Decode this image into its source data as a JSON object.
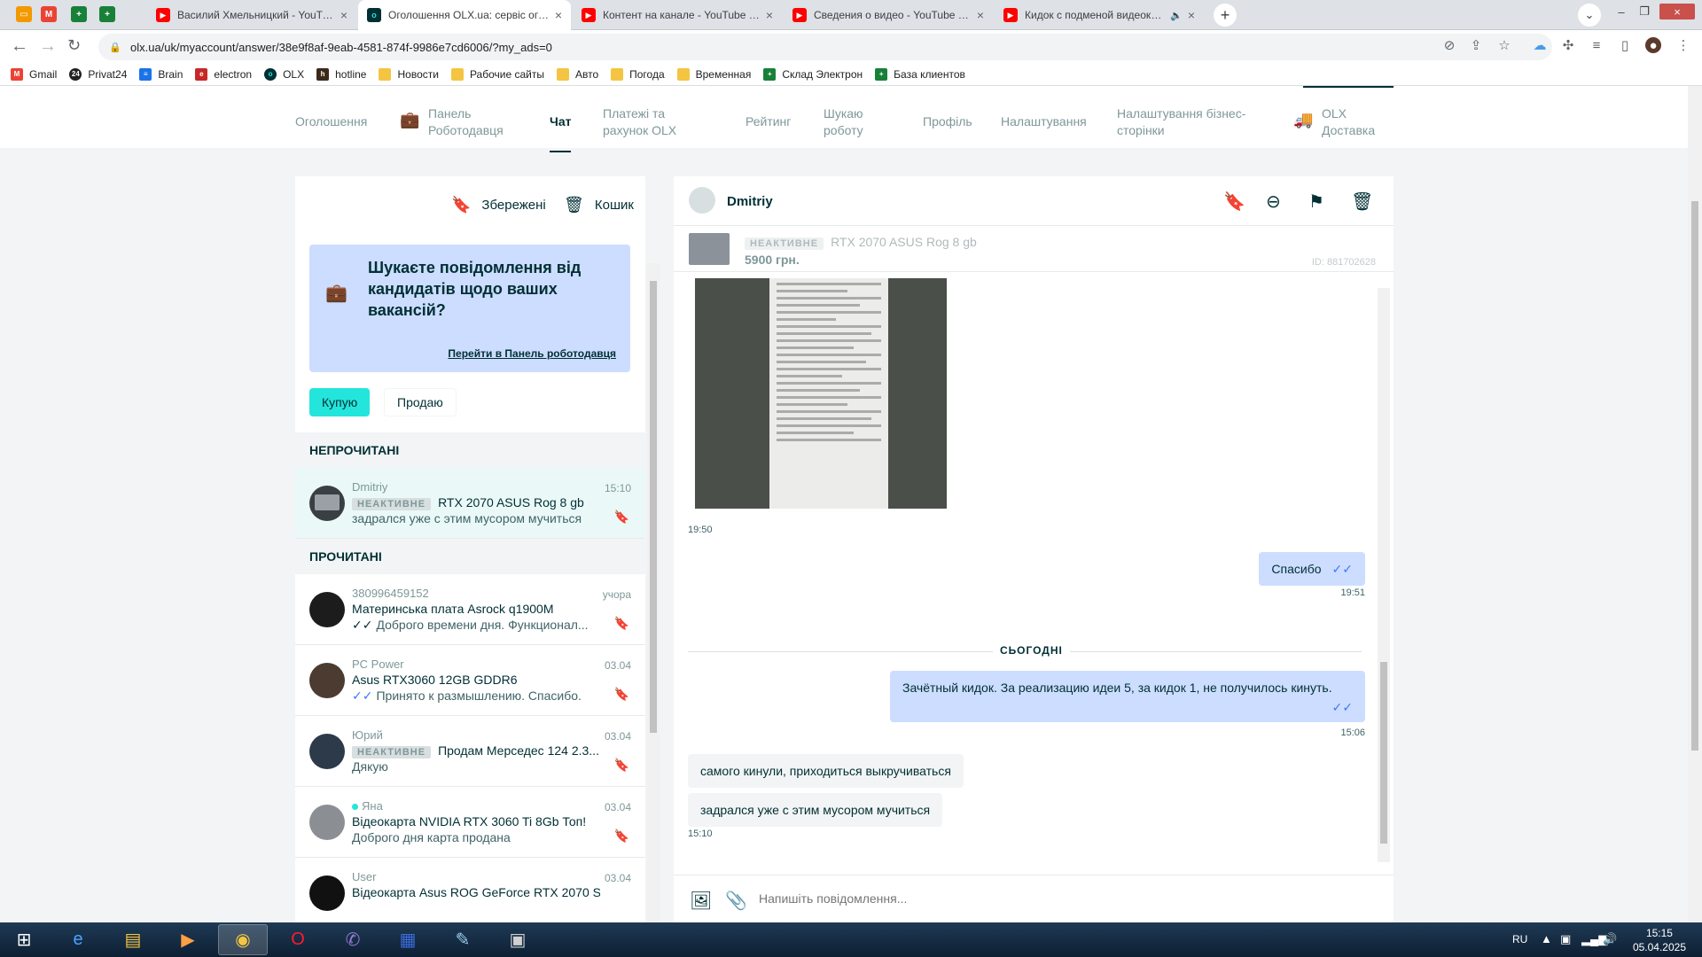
{
  "browser": {
    "pinned_tabs": [
      {
        "icon": "slides-icon",
        "color": "#f29900"
      },
      {
        "icon": "gmail-icon",
        "color": "#ea4335"
      },
      {
        "icon": "sheets-icon",
        "color": "#188038"
      },
      {
        "icon": "sheets-icon",
        "color": "#188038"
      }
    ],
    "tabs": [
      {
        "title": "Василий Хмельницкий - YouTube",
        "icon": "youtube-icon",
        "color": "#ff0000",
        "active": false
      },
      {
        "title": "Оголошення OLX.ua: сервіс оголошень",
        "icon": "olx-icon",
        "color": "#23e5db",
        "active": true
      },
      {
        "title": "Контент на канале - YouTube Studio",
        "icon": "youtube-icon",
        "color": "#ff0000",
        "active": false
      },
      {
        "title": "Сведения о видео - YouTube Studio",
        "icon": "youtube-icon",
        "color": "#ff0000",
        "active": false
      },
      {
        "title": "Кидок с подменой видеокарты",
        "icon": "youtube-icon",
        "color": "#ff0000",
        "active": false
      }
    ],
    "url": "olx.ua/uk/myaccount/answer/38e9f8af-9eab-4581-874f-9986e7cd6006/?my_ads=0",
    "bookmarks": [
      {
        "label": "Gmail",
        "icon": "gmail-icon",
        "color": "#ea4335"
      },
      {
        "label": "Privat24",
        "icon": "privat24-icon",
        "color": "#222222"
      },
      {
        "label": "Brain",
        "icon": "brain-icon",
        "color": "#1a73e8"
      },
      {
        "label": "electron",
        "icon": "electron-icon",
        "color": "#c62828"
      },
      {
        "label": "OLX",
        "icon": "olx-icon",
        "color": "#002f34"
      },
      {
        "label": "hotline",
        "icon": "hotline-icon",
        "color": "#3b2a1a"
      },
      {
        "label": "Новости",
        "icon": "folder-icon",
        "color": "#f4c542"
      },
      {
        "label": "Рабочие сайты",
        "icon": "folder-icon",
        "color": "#f4c542"
      },
      {
        "label": "Авто",
        "icon": "folder-icon",
        "color": "#f4c542"
      },
      {
        "label": "Погода",
        "icon": "folder-icon",
        "color": "#f4c542"
      },
      {
        "label": "Временная",
        "icon": "folder-icon",
        "color": "#f4c542"
      },
      {
        "label": "Склад Электрон",
        "icon": "sheets-icon",
        "color": "#188038"
      },
      {
        "label": "База клиентов",
        "icon": "sheets-icon",
        "color": "#188038"
      }
    ]
  },
  "account_nav": {
    "items": [
      {
        "label": "Оголошення",
        "line2": ""
      },
      {
        "label": "Панель",
        "line2": "Роботодавця"
      },
      {
        "label": "Чат",
        "line2": ""
      },
      {
        "label": "Платежі та",
        "line2": "рахунок OLX"
      },
      {
        "label": "Рейтинг",
        "line2": ""
      },
      {
        "label": "Шукаю",
        "line2": "роботу"
      },
      {
        "label": "Профіль",
        "line2": ""
      },
      {
        "label": "Налаштування",
        "line2": ""
      },
      {
        "label": "Налаштування бізнес-",
        "line2": "сторінки"
      },
      {
        "label": "OLX",
        "line2": "Доставка"
      }
    ]
  },
  "left": {
    "saved_label": "Збережені",
    "trash_label": "Кошик",
    "promo_title": "Шукаєте повідомлення від кандидатів щодо ваших вакансій?",
    "promo_link": "Перейти в Панель роботодавця",
    "tab_buy": "Купую",
    "tab_sell": "Продаю",
    "unread_header": "НЕПРОЧИТАНІ",
    "read_header": "ПРОЧИТАНІ",
    "conversations": [
      {
        "name": "Dmitriy",
        "badge": "НЕАКТИВНЕ",
        "title": "RTX 2070 ASUS Rog 8 gb",
        "message": "задрался уже с этим мусором мучиться",
        "date": "15:10",
        "online": false,
        "ticks": ""
      },
      {
        "name": "380996459152",
        "badge": "",
        "title": "Материнська плата Asrock q1900M",
        "message": "Доброго времени дня. Функционал...",
        "date": "учора",
        "online": false,
        "ticks": "✓✓"
      },
      {
        "name": "PC Power",
        "badge": "",
        "title": "Asus RTX3060 12GB GDDR6",
        "message": "Принято к размышлению. Спасибо.",
        "date": "03.04",
        "online": false,
        "ticks": "✓✓"
      },
      {
        "name": "Юрий",
        "badge": "НЕАКТИВНЕ",
        "title": "Продам Мерседес 124 2.3...",
        "message": "Дякую",
        "date": "03.04",
        "online": false,
        "ticks": ""
      },
      {
        "name": "Яна",
        "badge": "",
        "title": "Відеокарта NVIDIA RTX 3060 Ti 8Gb Топ!",
        "message": "Доброго дня карта продана",
        "date": "03.04",
        "online": true,
        "ticks": ""
      },
      {
        "name": "User",
        "badge": "",
        "title": "Відеокарта Asus ROG GeForce RTX 2070 S",
        "message": "",
        "date": "03.04",
        "online": false,
        "ticks": ""
      }
    ]
  },
  "chat": {
    "contact_name": "Dmitriy",
    "ad_status": "НЕАКТИВНЕ",
    "ad_title": "RTX 2070 ASUS Rog 8 gb",
    "ad_price": "5900 грн.",
    "ad_id": "ID: 881702628",
    "photo_time": "19:50",
    "messages": [
      {
        "text": "Спасибо",
        "time": "19:51",
        "mine": true
      },
      {
        "text": "Зачётный кидок. За реализацию идеи 5, за кидок 1, не получилось кинуть.",
        "time": "15:06",
        "mine": true
      },
      {
        "text": "самого кинули, приходиться выкручиваться",
        "time": "",
        "mine": false
      },
      {
        "text": "задрался уже с этим мусором мучиться",
        "time": "15:10",
        "mine": false
      }
    ],
    "day_divider": "СЬОГОДНІ",
    "composer_placeholder": "Напишіть повідомлення..."
  },
  "taskbar": {
    "lang": "RU",
    "time": "15:15",
    "date": "05.04.2025"
  }
}
